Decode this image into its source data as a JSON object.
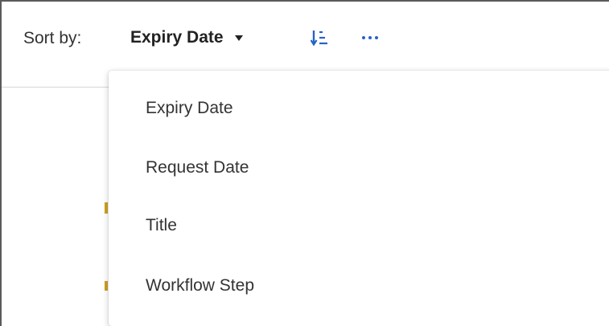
{
  "toolbar": {
    "sort_label": "Sort by:",
    "selected_sort": "Expiry Date",
    "icons": {
      "dropdown": "caret-down-icon",
      "direction": "sort-ascending-icon",
      "more": "more-horizontal-icon"
    }
  },
  "sort_menu": {
    "options": [
      "Expiry Date",
      "Request Date",
      "Title",
      "Workflow Step"
    ]
  },
  "colors": {
    "accent": "#2563c9",
    "text": "#333333"
  }
}
